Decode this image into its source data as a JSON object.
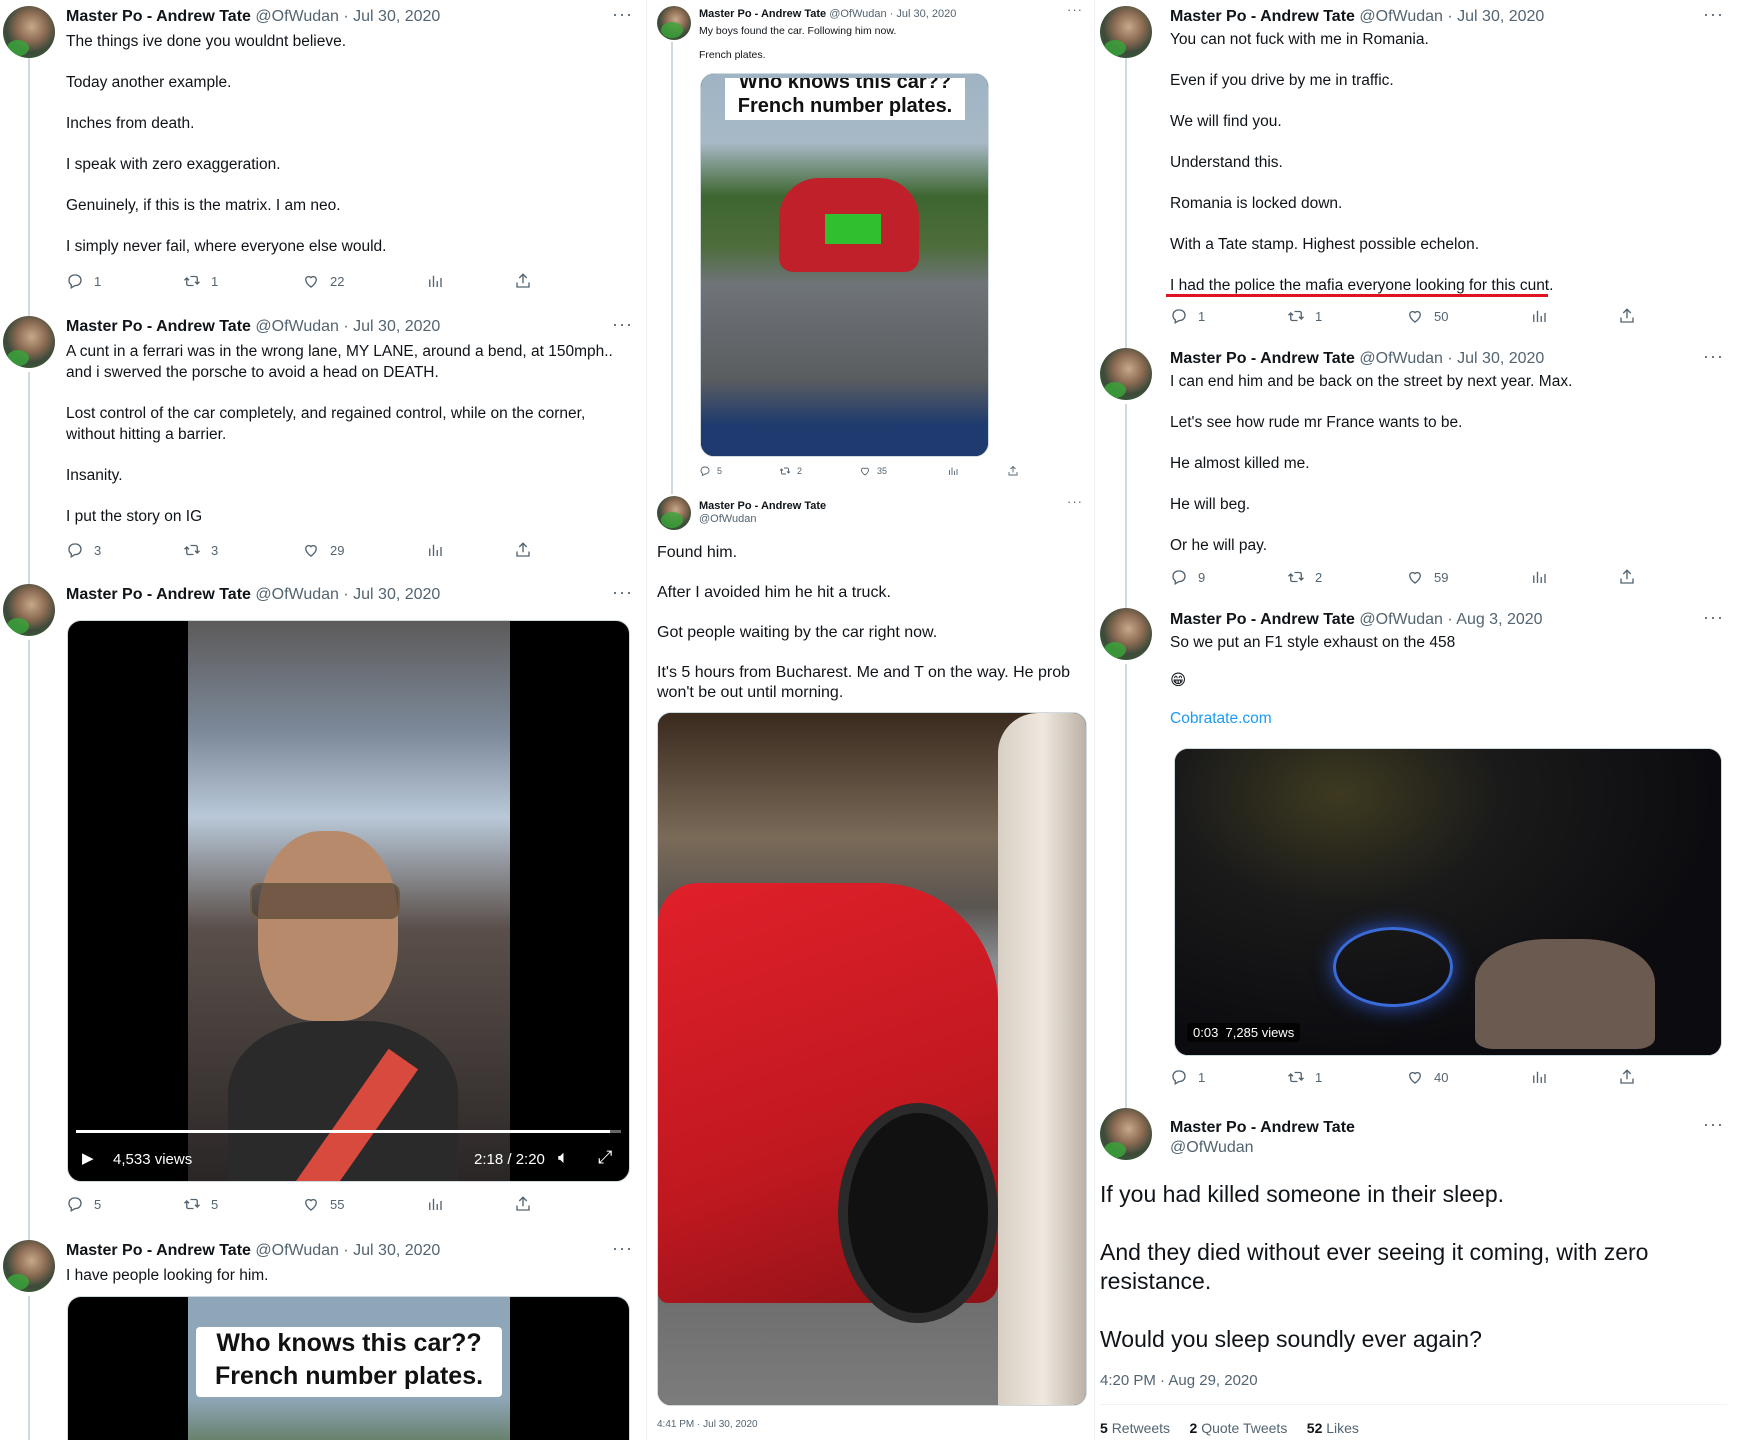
{
  "author": {
    "name": "Master Po - Andrew Tate",
    "handle": "@OfWudan"
  },
  "col1": {
    "t1": {
      "date": "Jul 30, 2020",
      "lines": [
        "The things ive done you wouldnt believe.",
        "Today another example.",
        "Inches from death.",
        "I speak with zero exaggeration.",
        "Genuinely, if this is the matrix. I am neo.",
        "I simply never fail, where everyone else would."
      ],
      "replies": "1",
      "retweets": "1",
      "likes": "22"
    },
    "t2": {
      "date": "Jul 30, 2020",
      "lines": [
        "A cunt in a ferrari was in the wrong lane, MY LANE, around a bend, at 150mph.. and i swerved the porsche to avoid a head on DEATH.",
        "Lost control of the car completely, and regained control, while on the corner, without hitting a barrier.",
        "Insanity.",
        "I put the story on IG"
      ],
      "replies": "3",
      "retweets": "3",
      "likes": "29"
    },
    "t3": {
      "date": "Jul 30, 2020",
      "video": {
        "views": "4,533 views",
        "time": "2:18 / 2:20",
        "progress": 0.98
      },
      "replies": "5",
      "retweets": "5",
      "likes": "55"
    },
    "t4": {
      "date": "Jul 30, 2020",
      "lines": [
        "I have people looking for him."
      ],
      "caption1": "Who knows this car??",
      "caption2": "French number plates."
    }
  },
  "col2": {
    "t1": {
      "date": "Jul 30, 2020",
      "line1": "My boys found the car. Following him now.",
      "line2": "French plates.",
      "caption1": "Who knows this car??",
      "caption2": "French number plates.",
      "replies": "5",
      "retweets": "2",
      "likes": "35"
    },
    "t2": {
      "lines": [
        "Found him.",
        "After I avoided him he hit a truck.",
        "Got people waiting by the car right now.",
        "It's 5 hours from Bucharest. Me and T on the way. He prob won't be out until morning."
      ],
      "timestamp": "4:41 PM · Jul 30, 2020"
    }
  },
  "col3": {
    "t1": {
      "date": "Jul 30, 2020",
      "lines": [
        "You can not fuck with me in Romania.",
        "Even if you drive by me in traffic.",
        "We will find you.",
        "Understand this.",
        "Romania is locked down.",
        "With a Tate stamp. Highest possible echelon.",
        "I had the police the mafia everyone looking for this cunt."
      ],
      "replies": "1",
      "retweets": "1",
      "likes": "50"
    },
    "t2": {
      "date": "Jul 30, 2020",
      "lines": [
        "I can end him and be back on the street by next year. Max.",
        "Let's see how rude mr France wants to be.",
        "He almost killed me.",
        "He will beg.",
        "Or he will pay."
      ],
      "replies": "9",
      "retweets": "2",
      "likes": "59"
    },
    "t3": {
      "date": "Aug 3, 2020",
      "line1": "So we put an F1 style exhaust on the 458",
      "emoji": "😁",
      "link": "Cobratate.com",
      "video": {
        "time": "0:03",
        "views": "7,285 views"
      },
      "replies": "1",
      "retweets": "1",
      "likes": "40"
    },
    "t4": {
      "lines": [
        "If you had killed someone in their sleep.",
        "And they died without ever seeing it coming, with zero resistance.",
        "Would you sleep soundly ever again?"
      ],
      "timestamp": "4:20 PM · Aug 29, 2020",
      "stats": {
        "retweets_n": "5",
        "retweets_l": "Retweets",
        "quotes_n": "2",
        "quotes_l": "Quote Tweets",
        "likes_n": "52",
        "likes_l": "Likes"
      }
    }
  }
}
